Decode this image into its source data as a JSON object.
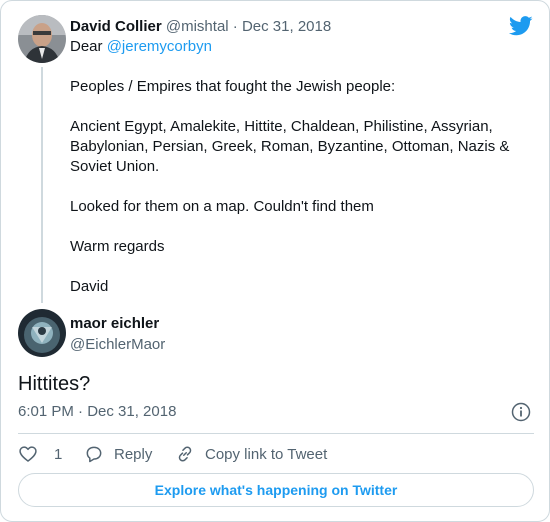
{
  "brand": {
    "logo_icon": "twitter-bird-icon",
    "accent_color": "#1d9bf0"
  },
  "parent_tweet": {
    "author_name": "David Collier",
    "author_handle": "@mishtal",
    "separator": "·",
    "date": "Dec 31, 2018",
    "greeting_prefix": "Dear ",
    "mention": "@jeremycorbyn",
    "paragraphs": [
      "Peoples / Empires that fought the Jewish people:",
      "Ancient Egypt, Amalekite, Hittite, Chaldean, Philistine, Assyrian, Babylonian, Persian, Greek, Roman, Byzantine, Ottoman, Nazis & Soviet Union.",
      "Looked for them on a map. Couldn't find them",
      "Warm regards",
      "David"
    ]
  },
  "main_tweet": {
    "author_name": "maor eichler",
    "author_handle": "@EichlerMaor",
    "text": "Hittites?",
    "timestamp": "6:01 PM · Dec 31, 2018",
    "info_icon": "info-icon"
  },
  "actions": {
    "like_count": "1",
    "reply_label": "Reply",
    "copy_label": "Copy link to Tweet"
  },
  "footer": {
    "explore_label": "Explore what's happening on Twitter"
  }
}
